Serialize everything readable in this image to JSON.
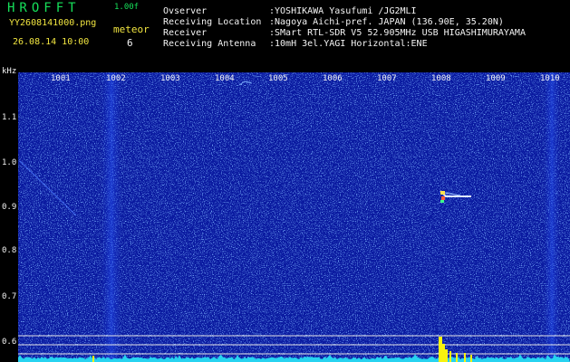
{
  "header": {
    "logo": "HROFFT",
    "version": "1.00f",
    "filename": "YY2608141000.png",
    "datetime": "26.08.14 10:00",
    "meteor_label": "meteor",
    "meteor_count": "6"
  },
  "info": {
    "labels": [
      "Ovserver",
      "Receiving Location",
      "Receiver",
      "Receiving Antenna"
    ],
    "values": [
      ":YOSHIKAWA Yasufumi /JG2MLI",
      ":Nagoya Aichi-pref. JAPAN (136.90E, 35.20N)",
      ":SMart RTL-SDR V5 52.905MHz USB HIGASHIMURAYAMA",
      ":10mH 3el.YAGI Horizontal:ENE"
    ]
  },
  "axes": {
    "y_unit": "kHz",
    "x_ticks": [
      "1001",
      "1002",
      "1003",
      "1004",
      "1005",
      "1006",
      "1007",
      "1008",
      "1009",
      "1010"
    ],
    "y_ticks": [
      "1.1",
      "1.0",
      "0.9",
      "0.8",
      "0.7",
      "0.6"
    ]
  },
  "colors": {
    "background": "#000000",
    "spectrogram": "#0b1ca8",
    "header_green": "#16e05a",
    "header_yellow": "#f2e640",
    "noise_floor": "#27d3f0",
    "burst": "#f7f20f"
  }
}
